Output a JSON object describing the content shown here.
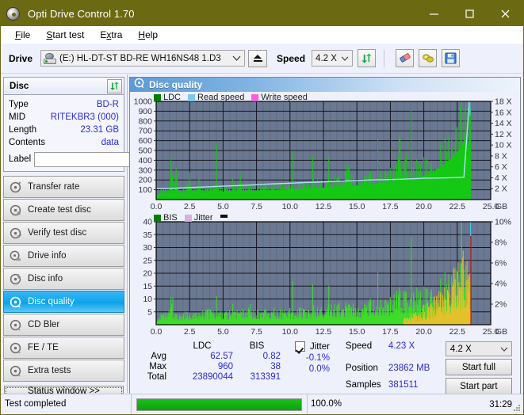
{
  "window": {
    "title": "Opti Drive Control 1.70",
    "icon": "disc-icon",
    "minimize": "minimize-button",
    "maximize": "maximize-button",
    "close": "close-button"
  },
  "menu": {
    "items": [
      {
        "label": "File",
        "accel": "F"
      },
      {
        "label": "Start test",
        "accel": "S"
      },
      {
        "label": "Extra",
        "accel": "x"
      },
      {
        "label": "Help",
        "accel": "H"
      }
    ]
  },
  "toolbar": {
    "drive_label": "Drive",
    "drive_value": "(E:)  HL-DT-ST BD-RE  WH16NS48 1.D3",
    "eject": "eject-button",
    "speed_label": "Speed",
    "speed_value": "4.2 X",
    "icons": [
      "refresh-icon",
      "eraser-icon",
      "settings-icon",
      "save-icon"
    ]
  },
  "disc": {
    "header": "Disc",
    "refresh": "refresh-button",
    "rows": [
      {
        "key": "Type",
        "value": "BD-R"
      },
      {
        "key": "MID",
        "value": "RITEKBR3 (000)"
      },
      {
        "key": "Length",
        "value": "23.31 GB"
      },
      {
        "key": "Contents",
        "value": "data"
      }
    ],
    "label_key": "Label",
    "label_value": "",
    "label_placeholder": ""
  },
  "nav": {
    "items": [
      {
        "label": "Transfer rate",
        "selected": false
      },
      {
        "label": "Create test disc",
        "selected": false
      },
      {
        "label": "Verify test disc",
        "selected": false
      },
      {
        "label": "Drive info",
        "selected": false
      },
      {
        "label": "Disc info",
        "selected": false
      },
      {
        "label": "Disc quality",
        "selected": true
      },
      {
        "label": "CD Bler",
        "selected": false
      },
      {
        "label": "FE / TE",
        "selected": false
      },
      {
        "label": "Extra tests",
        "selected": false
      }
    ],
    "status_window": "Status window >>"
  },
  "panel": {
    "title": "Disc quality",
    "icon": "disc-quality-icon"
  },
  "chart_data": [
    {
      "type": "area",
      "name": "ldc-chart",
      "title": "",
      "xlabel": "GB",
      "ylabel": "",
      "xlim": [
        0,
        25
      ],
      "ylim": [
        0,
        1000
      ],
      "y2lim": [
        0,
        18
      ],
      "y2label": "X",
      "grid": true,
      "legend": [
        "LDC",
        "Read speed",
        "Write speed"
      ],
      "legend_colors": [
        "#008000",
        "#7ec8f0",
        "#ff5ce0"
      ],
      "legend_position": "top-left",
      "xticks": [
        "0.0",
        "2.5",
        "5.0",
        "7.5",
        "10.0",
        "12.5",
        "15.0",
        "17.5",
        "20.0",
        "22.5",
        "25.0"
      ],
      "yticks": [
        "100",
        "200",
        "300",
        "400",
        "500",
        "600",
        "700",
        "800",
        "900",
        "1000"
      ],
      "y2ticks": [
        "2 X",
        "4 X",
        "6 X",
        "8 X",
        "10 X",
        "12 X",
        "14 X",
        "16 X",
        "18 X"
      ],
      "series": [
        {
          "name": "LDC",
          "color": "#14c814",
          "x": [
            0.0,
            0.2,
            0.4,
            0.6,
            0.8,
            1.0,
            1.15,
            1.2,
            1.3,
            1.5,
            1.7,
            1.85,
            2.0,
            2.2,
            2.5,
            2.7,
            2.9,
            3.0,
            3.2,
            3.4,
            3.6,
            3.7,
            3.9,
            4.1,
            4.3,
            4.5,
            4.7,
            4.9,
            5.0,
            5.1,
            5.3,
            5.5,
            5.7,
            5.9,
            6.1,
            6.3,
            6.4,
            6.6,
            6.8,
            7.0,
            7.2,
            7.4,
            7.6,
            7.8,
            8.0,
            8.3,
            8.6,
            8.9,
            9.2,
            9.5,
            9.8,
            10.1,
            10.4,
            10.7,
            11.0,
            11.3,
            11.6,
            11.9,
            12.2,
            12.5,
            12.8,
            13.1,
            13.4,
            13.7,
            14.0,
            14.3,
            14.6,
            14.9,
            15.2,
            15.5,
            15.8,
            16.1,
            16.4,
            16.7,
            17.0,
            17.3,
            17.6,
            17.9,
            18.2,
            18.5,
            18.7,
            18.9,
            19.2,
            19.5,
            19.8,
            20.1,
            20.4,
            20.7,
            21.0,
            21.3,
            21.6,
            21.9,
            22.2,
            22.5,
            22.8,
            23.0,
            23.2,
            23.35,
            23.45
          ],
          "y": [
            70,
            85,
            95,
            100,
            105,
            110,
            560,
            120,
            110,
            315,
            115,
            110,
            108,
            110,
            265,
            120,
            115,
            118,
            230,
            125,
            120,
            122,
            128,
            120,
            125,
            290,
            130,
            125,
            130,
            128,
            132,
            135,
            138,
            130,
            135,
            270,
            140,
            138,
            142,
            150,
            145,
            148,
            150,
            155,
            160,
            155,
            158,
            160,
            165,
            162,
            168,
            170,
            175,
            172,
            178,
            180,
            185,
            190,
            188,
            195,
            200,
            205,
            210,
            215,
            220,
            350,
            225,
            230,
            235,
            240,
            245,
            250,
            260,
            270,
            275,
            280,
            290,
            300,
            600,
            310,
            430,
            320,
            340,
            360,
            380,
            400,
            430,
            460,
            500,
            540,
            590,
            650,
            700,
            780,
            860,
            940,
            975,
            960,
            900
          ]
        },
        {
          "name": "Read speed",
          "color": "#aee0f7",
          "x": [
            0.0,
            1.0,
            2.0,
            3.0,
            4.0,
            5.0,
            6.0,
            7.0,
            8.0,
            9.0,
            10.0,
            11.0,
            12.0,
            13.0,
            14.0,
            15.0,
            16.0,
            17.0,
            18.0,
            19.0,
            20.0,
            21.0,
            22.0,
            23.0,
            23.4
          ],
          "y": [
            2.0,
            2.05,
            2.15,
            2.25,
            2.35,
            2.45,
            2.55,
            2.65,
            2.8,
            2.9,
            3.0,
            3.1,
            3.2,
            3.3,
            3.4,
            3.5,
            3.6,
            3.65,
            3.7,
            3.8,
            3.9,
            3.95,
            4.0,
            4.1,
            18.0
          ]
        }
      ]
    },
    {
      "type": "area",
      "name": "bis-chart",
      "title": "",
      "xlabel": "GB",
      "ylabel": "",
      "xlim": [
        0,
        25
      ],
      "ylim": [
        0,
        40
      ],
      "y2lim": [
        0,
        10
      ],
      "y2label": "%",
      "grid": true,
      "legend": [
        "BIS",
        "Jitter"
      ],
      "legend_colors": [
        "#008000",
        "#d8b0e0"
      ],
      "legend_position": "top-left",
      "xticks": [
        "0.0",
        "2.5",
        "5.0",
        "7.5",
        "10.0",
        "12.5",
        "15.0",
        "17.5",
        "20.0",
        "22.5",
        "25.0"
      ],
      "yticks": [
        "5",
        "10",
        "15",
        "20",
        "25",
        "30",
        "35",
        "40"
      ],
      "y2ticks": [
        "2%",
        "4%",
        "6%",
        "8%",
        "10%"
      ],
      "series": [
        {
          "name": "BIS",
          "color": "#3ddc2a",
          "x": [
            0.0,
            0.3,
            0.6,
            0.9,
            1.15,
            1.25,
            1.5,
            1.8,
            2.1,
            2.4,
            2.7,
            3.0,
            3.3,
            3.6,
            3.9,
            4.1,
            4.3,
            4.6,
            4.9,
            5.2,
            5.5,
            5.8,
            6.1,
            6.4,
            6.7,
            7.0,
            7.3,
            7.5,
            7.8,
            8.1,
            8.4,
            8.7,
            9.0,
            9.3,
            9.6,
            9.9,
            10.2,
            10.5,
            10.8,
            11.1,
            11.4,
            11.7,
            12.0,
            12.3,
            12.6,
            12.9,
            13.2,
            13.5,
            13.8,
            14.1,
            14.4,
            14.7,
            15.0,
            15.3,
            15.6,
            15.9,
            16.2,
            16.5,
            16.8,
            17.1,
            17.4,
            17.7,
            18.0,
            18.3,
            18.6,
            18.9,
            19.2,
            19.5,
            19.8,
            20.1,
            20.4,
            20.7,
            21.0,
            21.3,
            21.6,
            21.9,
            22.2,
            22.5,
            22.8,
            23.0,
            23.2,
            23.35,
            23.45
          ],
          "y": [
            3.5,
            3.8,
            4.0,
            4.2,
            12.0,
            4.5,
            4.0,
            4.2,
            4.5,
            4.3,
            4.6,
            4.8,
            5.0,
            5.2,
            7.0,
            5.0,
            5.2,
            5.4,
            5.0,
            5.2,
            5.5,
            5.3,
            5.6,
            5.4,
            5.7,
            7.5,
            5.5,
            5.8,
            5.6,
            5.9,
            5.7,
            6.0,
            5.8,
            6.1,
            5.9,
            6.2,
            6.0,
            6.3,
            6.1,
            6.4,
            6.2,
            6.5,
            6.3,
            6.6,
            6.8,
            7.0,
            7.2,
            7.0,
            7.4,
            7.2,
            7.6,
            7.4,
            7.8,
            7.6,
            8.0,
            8.5,
            9.0,
            8.6,
            9.2,
            9.0,
            9.5,
            10.0,
            14.5,
            11.0,
            12.0,
            11.5,
            13.0,
            12.5,
            14.0,
            13.5,
            15.0,
            16.0,
            18.0,
            17.0,
            19.0,
            20.0,
            21.0,
            22.0,
            20.0,
            21.5,
            19.0,
            18.0,
            16.0
          ]
        },
        {
          "name": "Jitter",
          "color": "#e8c02a",
          "x": [
            18.5,
            19.0,
            19.5,
            20.0,
            20.5,
            21.0,
            21.3,
            21.6,
            21.9,
            22.2,
            22.5,
            22.8,
            23.0,
            23.2,
            23.35,
            23.45
          ],
          "y": [
            0.5,
            0.8,
            1.0,
            1.4,
            1.8,
            2.2,
            2.6,
            3.0,
            3.4,
            4.0,
            4.4,
            5.0,
            5.2,
            4.8,
            5.3,
            4.6
          ]
        }
      ],
      "markers": {
        "end_line_x": 23.5,
        "end_line_color": "#cc1111",
        "peak_marker_color": "#49c2e8"
      }
    }
  ],
  "stats": {
    "columns": [
      "LDC",
      "BIS"
    ],
    "rows": [
      {
        "label": "Avg",
        "ldc": "62.57",
        "bis": "0.82"
      },
      {
        "label": "Max",
        "ldc": "960",
        "bis": "38"
      },
      {
        "label": "Total",
        "ldc": "23890044",
        "bis": "313391"
      }
    ],
    "jitter": {
      "checkbox_label": "Jitter",
      "checked": true,
      "avg": "-0.1%",
      "max": "0.0%"
    },
    "right": {
      "speed_key": "Speed",
      "speed_value": "4.23 X",
      "position_key": "Position",
      "position_value": "23862 MB",
      "samples_key": "Samples",
      "samples_value": "381511",
      "speed_select": "4.2 X",
      "start_full": "Start full",
      "start_part": "Start part"
    }
  },
  "statusbar": {
    "text": "Test completed",
    "progress_pct": 100.0,
    "progress_label": "100.0%",
    "time": "31:29"
  }
}
